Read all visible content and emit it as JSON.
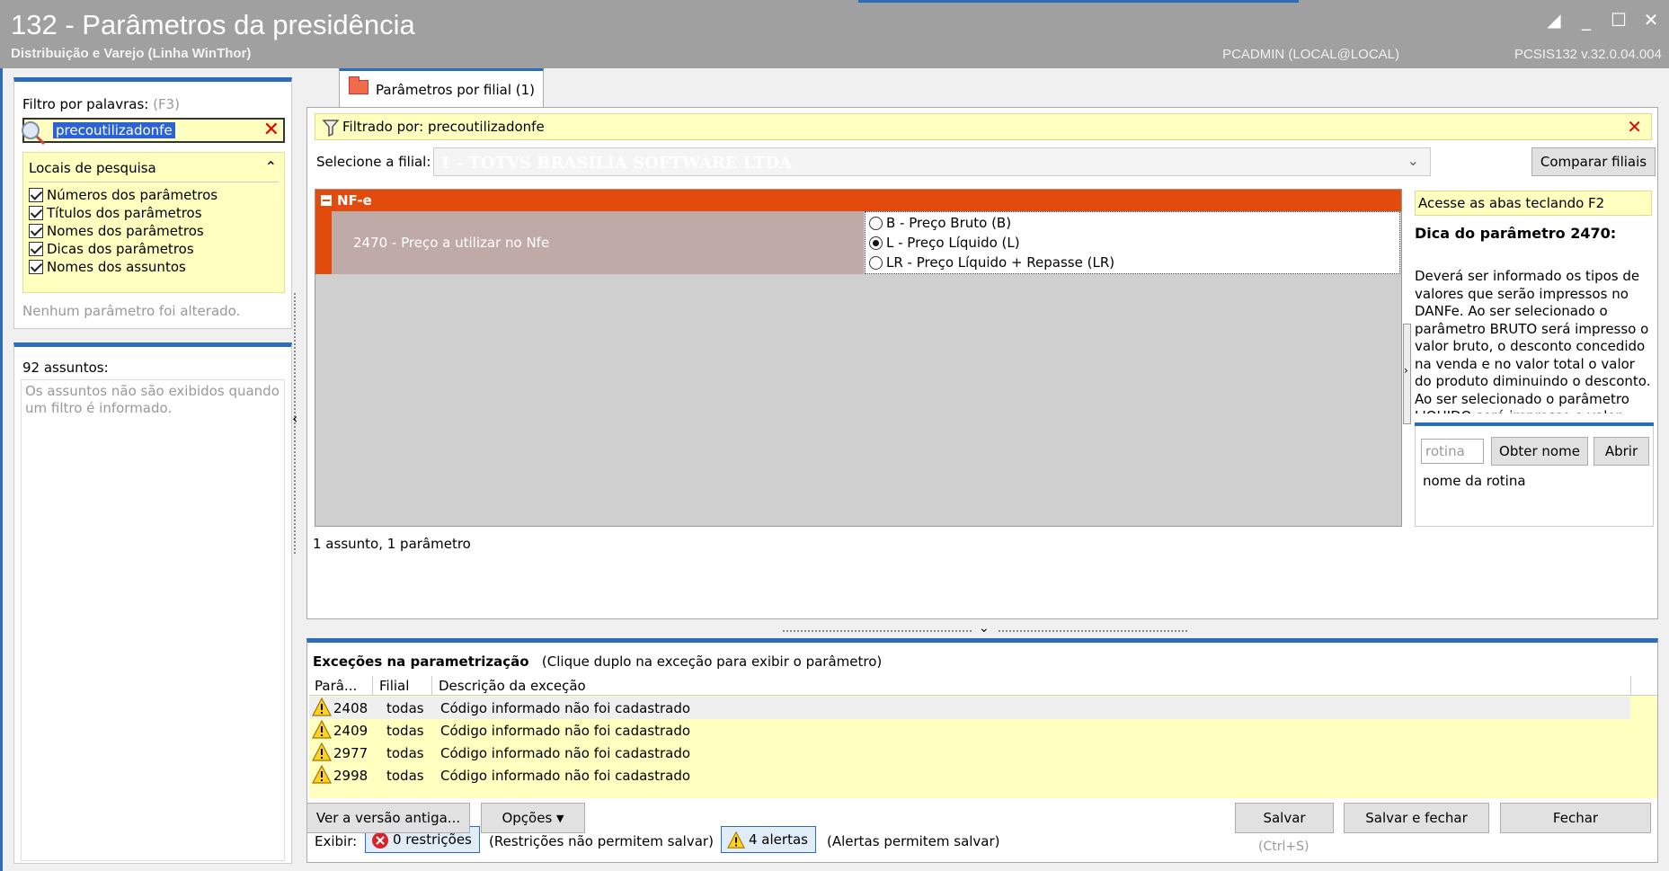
{
  "window": {
    "title": "132 - Parâmetros da presidência",
    "subtitle": "Distribuição e Varejo (Linha WinThor)",
    "user": "PCADMIN (LOCAL@LOCAL)",
    "version": "PCSIS132  v.32.0.04.004"
  },
  "filter": {
    "label": "Filtro por palavras:",
    "shortcut": "(F3)",
    "value": "precoutilizadonfe",
    "locais_title": "Locais de pesquisa",
    "options": [
      "Números dos parâmetros",
      "Títulos dos parâmetros",
      "Nomes dos parâmetros",
      "Dicas dos parâmetros",
      "Nomes dos assuntos"
    ],
    "no_change": "Nenhum parâmetro foi alterado."
  },
  "assuntos": {
    "count_label": "92 assuntos:",
    "message": "Os assuntos não são exibidos quando um filtro é informado."
  },
  "tab": {
    "label": "Parâmetros por filial  (1)"
  },
  "filtered": {
    "label": "Filtrado por: precoutilizadonfe"
  },
  "filial": {
    "label": "Selecione a filial:",
    "selected": "1 - TOTVS BRASILIA SOFTWARE LTDA",
    "compare_button": "Comparar filiais"
  },
  "grid": {
    "group": "NF-e",
    "param_label": "2470 - Preço a utilizar no Nfe",
    "options": [
      {
        "label": "B - Preço Bruto (B)",
        "checked": false
      },
      {
        "label": "L - Preço Líquido (L)",
        "checked": true
      },
      {
        "label": "LR - Preço Líquido + Repasse (LR)",
        "checked": false
      }
    ],
    "summary": "1 assunto, 1 parâmetro"
  },
  "tip": {
    "access": "Acesse as abas teclando F2",
    "title": "Dica do parâmetro 2470:",
    "text": "Deverá ser informado os tipos de valores que serão impressos no DANFe. Ao ser selecionado o parâmetro BRUTO será impresso o valor bruto, o desconto concedido na venda e no valor total o valor do produto diminuindo o desconto. Ao ser selecionado o parâmetro LIQUIDO será impresso o valor liquido",
    "rotina_placeholder": "rotina",
    "obter_button": "Obter nome",
    "abrir_button": "Abrir",
    "rotina_label": "nome da rotina"
  },
  "exceptions": {
    "title": "Exceções na parametrização",
    "hint": "(Clique duplo na exceção para exibir o parâmetro)",
    "columns": [
      "Parâ...",
      "Filial",
      "Descrição da exceção"
    ],
    "rows": [
      {
        "param": "2408",
        "filial": "todas",
        "desc": "Código informado não foi cadastrado"
      },
      {
        "param": "2409",
        "filial": "todas",
        "desc": "Código informado não foi cadastrado"
      },
      {
        "param": "2977",
        "filial": "todas",
        "desc": "Código informado não foi cadastrado"
      },
      {
        "param": "2998",
        "filial": "todas",
        "desc": "Código informado não foi cadastrado"
      }
    ],
    "exibir_label": "Exibir:",
    "restricoes_button": "0 restrições",
    "restricoes_hint": "(Restrições não permitem salvar)",
    "alertas_button": "4 alertas",
    "alertas_hint": "(Alertas permitem salvar)"
  },
  "footer": {
    "old_version_button": "Ver a versão antiga...",
    "options_button": "Opções",
    "save_button": "Salvar",
    "save_hint": "(Ctrl+S)",
    "save_close_button": "Salvar e fechar",
    "close_button": "Fechar"
  },
  "colors": {
    "accent": "#2d6db7",
    "group": "#e34b0c",
    "highlight": "#ffffc0"
  }
}
